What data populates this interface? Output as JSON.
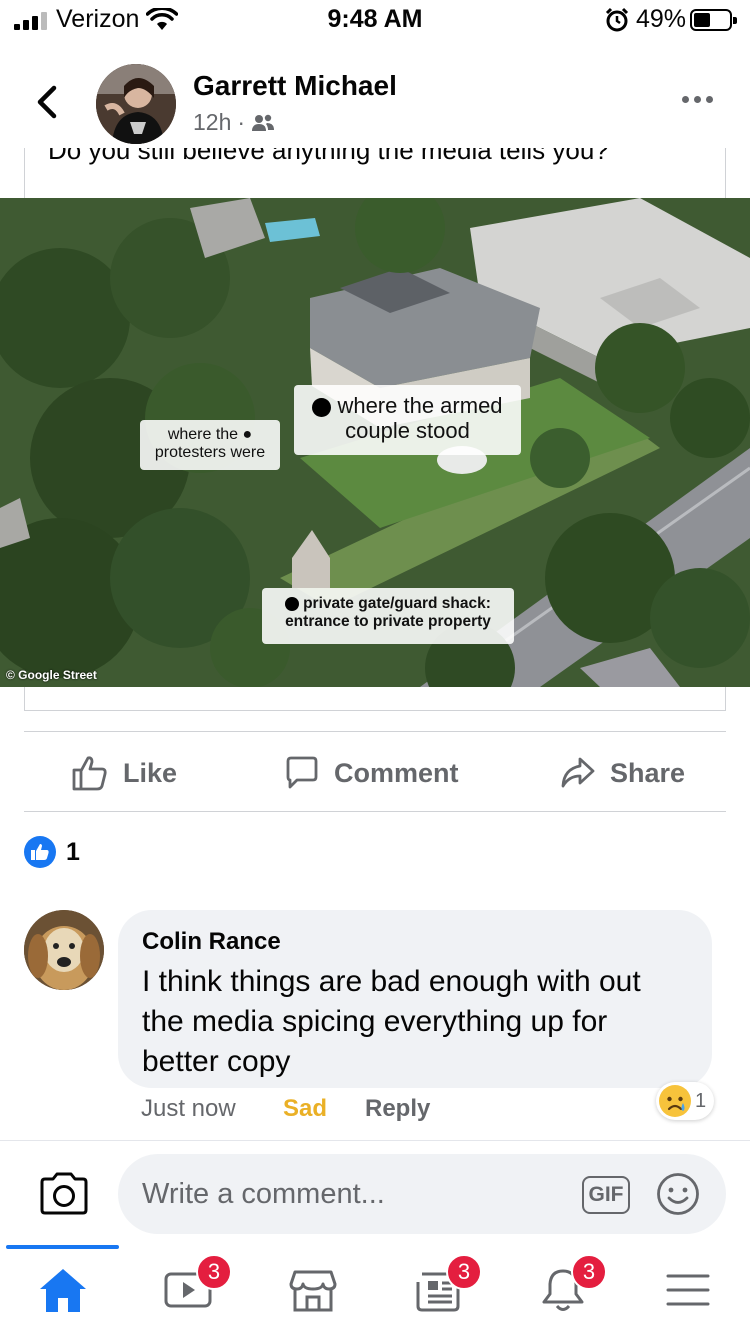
{
  "status_bar": {
    "carrier": "Verizon",
    "time": "9:48 AM",
    "battery_percent": "49%",
    "battery_level": 0.49
  },
  "post": {
    "author": "Garrett Michael",
    "time": "12h",
    "audience_icon": "friends-icon",
    "clipped_text": "Do you still believe anything the media tells you?",
    "image": {
      "label_protesters": "where the ● protesters were",
      "label_couple": "where the armed couple stood",
      "label_gate": "private gate/guard shack: entrance to private property",
      "credit": "© Google Street"
    }
  },
  "actions": {
    "like": "Like",
    "comment": "Comment",
    "share": "Share"
  },
  "reactions": {
    "count": "1",
    "type": "like"
  },
  "comment": {
    "author": "Colin Rance",
    "text": "I think things are bad enough with out the media spicing everything up for better copy",
    "time": "Just now",
    "reaction_label": "Sad",
    "reply": "Reply",
    "reaction_count": "1"
  },
  "composer": {
    "placeholder": "Write a comment...",
    "gif": "GIF"
  },
  "tabs": [
    {
      "name": "home",
      "badge": ""
    },
    {
      "name": "watch",
      "badge": "3"
    },
    {
      "name": "marketplace",
      "badge": ""
    },
    {
      "name": "news",
      "badge": "3"
    },
    {
      "name": "notifications",
      "badge": "3"
    },
    {
      "name": "menu",
      "badge": ""
    }
  ],
  "colors": {
    "accent": "#1877f2",
    "badge": "#e41e3f",
    "sad": "#eab026",
    "secondary_text": "#65676b"
  }
}
